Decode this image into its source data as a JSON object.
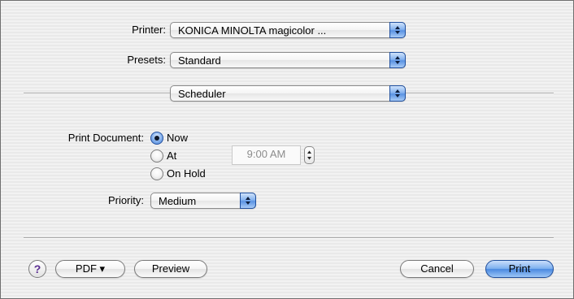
{
  "printer": {
    "label": "Printer:",
    "value": "KONICA MINOLTA magicolor ..."
  },
  "presets": {
    "label": "Presets:",
    "value": "Standard"
  },
  "panel": {
    "value": "Scheduler"
  },
  "print_document": {
    "label": "Print Document:",
    "options": [
      {
        "label": "Now",
        "selected": true
      },
      {
        "label": "At",
        "selected": false
      },
      {
        "label": "On Hold",
        "selected": false
      }
    ],
    "time": "9:00 AM"
  },
  "priority": {
    "label": "Priority:",
    "value": "Medium"
  },
  "buttons": {
    "help": "?",
    "pdf": "PDF ▾",
    "preview": "Preview",
    "cancel": "Cancel",
    "print": "Print"
  },
  "colors": {
    "accent": "#5a93e3",
    "help_glyph": "#5a2d91"
  }
}
